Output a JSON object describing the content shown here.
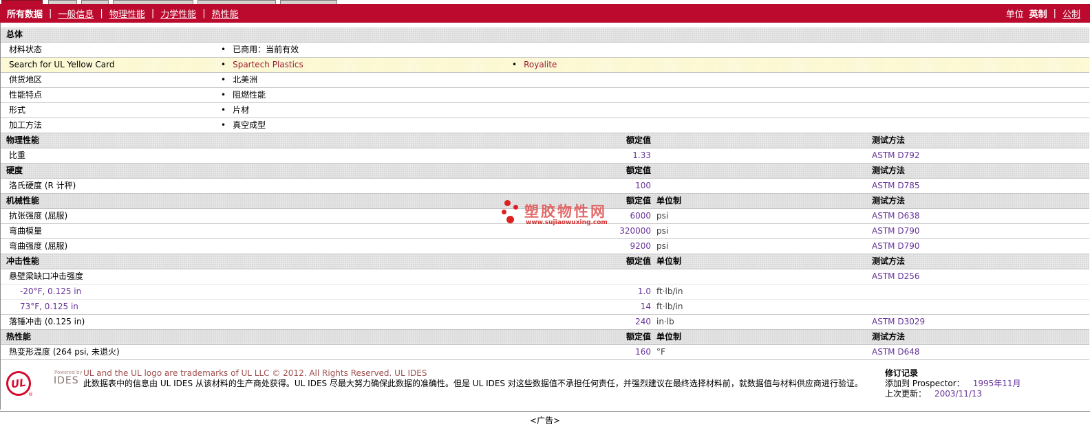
{
  "nav": {
    "items": [
      {
        "label": "所有数据",
        "active": true
      },
      {
        "label": "一般信息",
        "active": false
      },
      {
        "label": "物理性能",
        "active": false
      },
      {
        "label": "力学性能",
        "active": false
      },
      {
        "label": "热性能",
        "active": false
      }
    ],
    "separator": "|",
    "units": {
      "label": "单位",
      "english": "英制",
      "metric": "公制"
    }
  },
  "table": {
    "rows": [
      {
        "type": "section",
        "label": "总体"
      },
      {
        "type": "info",
        "label": "材料状态",
        "bullets": [
          {
            "bullet": "•",
            "text": "已商用：当前有效"
          }
        ]
      },
      {
        "type": "highlight",
        "label": "Search for UL Yellow Card",
        "bullets": [
          {
            "bullet": "•",
            "text": "Spartech Plastics"
          },
          {
            "bullet": "•",
            "text": "Royalite"
          }
        ]
      },
      {
        "type": "info",
        "label": "供货地区",
        "bullets": [
          {
            "bullet": "•",
            "text": "北美洲"
          }
        ]
      },
      {
        "type": "info",
        "label": "性能特点",
        "bullets": [
          {
            "bullet": "•",
            "text": "阻燃性能"
          }
        ]
      },
      {
        "type": "info",
        "label": "形式",
        "bullets": [
          {
            "bullet": "•",
            "text": "片材"
          }
        ]
      },
      {
        "type": "info",
        "label": "加工方法",
        "bullets": [
          {
            "bullet": "•",
            "text": "真空成型"
          }
        ]
      },
      {
        "type": "section",
        "label": "物理性能",
        "value_header": "额定值",
        "method_header": "测试方法"
      },
      {
        "type": "prop",
        "label": "比重",
        "value": "1.33",
        "unit": "",
        "method": "ASTM D792"
      },
      {
        "type": "section",
        "label": "硬度",
        "value_header": "额定值",
        "method_header": "测试方法"
      },
      {
        "type": "prop",
        "label": "洛氏硬度 (R 计秤)",
        "value": "100",
        "unit": "",
        "method": "ASTM D785"
      },
      {
        "type": "section",
        "label": "机械性能",
        "value_header": "额定值",
        "unit_header": "单位制",
        "method_header": "测试方法"
      },
      {
        "type": "prop",
        "label": "抗张强度 (屈服)",
        "value": "6000",
        "unit": "psi",
        "method": "ASTM D638"
      },
      {
        "type": "prop",
        "label": "弯曲模量",
        "value": "320000",
        "unit": "psi",
        "method": "ASTM D790"
      },
      {
        "type": "prop",
        "label": "弯曲强度 (屈服)",
        "value": "9200",
        "unit": "psi",
        "method": "ASTM D790"
      },
      {
        "type": "section",
        "label": "冲击性能",
        "value_header": "额定值",
        "unit_header": "单位制",
        "method_header": "测试方法"
      },
      {
        "type": "prop",
        "label": "悬壁梁缺口冲击强度",
        "value": "",
        "unit": "",
        "method": "ASTM D256"
      },
      {
        "type": "sub",
        "label": "-20°F, 0.125 in",
        "value": "1.0",
        "unit": "ft·lb/in",
        "method": ""
      },
      {
        "type": "sub",
        "label": "73°F, 0.125 in",
        "value": "14",
        "unit": "ft·lb/in",
        "method": ""
      },
      {
        "type": "prop",
        "label": "落锤冲击 (0.125 in)",
        "value": "240",
        "unit": "in·lb",
        "method": "ASTM D3029"
      },
      {
        "type": "section",
        "label": "热性能",
        "value_header": "额定值",
        "unit_header": "单位制",
        "method_header": "测试方法"
      },
      {
        "type": "prop",
        "label": "热变形温度 (264 psi, 未退火)",
        "value": "160",
        "unit": "°F",
        "method": "ASTM D648"
      }
    ]
  },
  "watermark": {
    "title": "塑胶物性网",
    "url": "www.sujiaowuxing.com"
  },
  "footer": {
    "ul_logo_text": "UL",
    "registered_mark": "®",
    "powered_by": "Powered by",
    "ides": "IDES",
    "trademark_en": "UL and the UL logo are trademarks of UL LLC © 2012. All Rights Reserved. UL IDES",
    "disclaimer_zh": "此数据表中的信息由 UL IDES 从该材料的生产商处获得。UL IDES 尽最大努力确保此数据的准确性。但是 UL IDES 对这些数据值不承担任何责任，并强烈建议在最终选择材料前，就数据值与材料供应商进行验证。",
    "revision": {
      "title": "修订记录",
      "added_label": "添加到 Prospector：",
      "added_value": "1995年11月",
      "updated_label": "上次更新：",
      "updated_value": "2003/11/13"
    }
  },
  "ad_label": "<广告>",
  "colors": {
    "nav_red": "#BB0A2E",
    "value_purple": "#663399",
    "link_maroon": "#9B1B30",
    "highlight_yellow": "#FBF7CF",
    "section_gray": "#DBDBDB",
    "watermark_red": "#E05A5A"
  }
}
